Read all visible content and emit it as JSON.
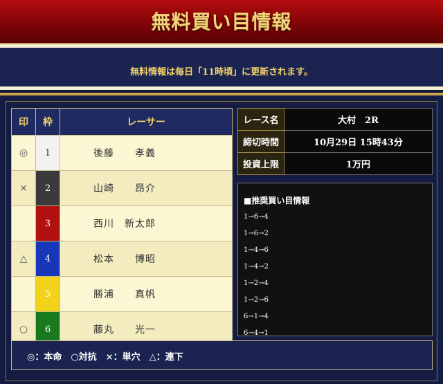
{
  "banner": {
    "title": "無料買い目情報"
  },
  "notice": {
    "text": "無料情報は毎日「11時頃」に更新されます。"
  },
  "table": {
    "headers": [
      "印",
      "枠",
      "レーサー"
    ],
    "rows": [
      {
        "mark": "◎",
        "frame": "1",
        "frame_color": "#f2f2f2",
        "frame_text_color": "#333333",
        "name": "後藤　　孝義"
      },
      {
        "mark": "×",
        "frame": "2",
        "frame_color": "#3a3a3a",
        "frame_text_color": "#ffffff",
        "name": "山崎　　昂介"
      },
      {
        "mark": "",
        "frame": "3",
        "frame_color": "#b01010",
        "frame_text_color": "#ffffff",
        "name": "西川　新太郎"
      },
      {
        "mark": "△",
        "frame": "4",
        "frame_color": "#1736b8",
        "frame_text_color": "#ffffff",
        "name": "松本　　博昭"
      },
      {
        "mark": "",
        "frame": "5",
        "frame_color": "#f2d21a",
        "frame_text_color": "#ffffff",
        "name": "勝浦　　真帆"
      },
      {
        "mark": "○",
        "frame": "6",
        "frame_color": "#187a1c",
        "frame_text_color": "#ffffff",
        "name": "藤丸　　光一"
      }
    ]
  },
  "race_info": [
    {
      "label": "レース名",
      "value": "大村　2R"
    },
    {
      "label": "締切時間",
      "value": "10月29日 15時43分"
    },
    {
      "label": "投資上限",
      "value": "1万円"
    }
  ],
  "recommend": {
    "title": "■推奨買い目情報",
    "items": [
      "1→6→4",
      "1→6→2",
      "1→4→6",
      "1→4→2",
      "1→2→4",
      "1→2→6",
      "6→1→4",
      "6→4→1"
    ]
  },
  "legend": {
    "text": "◎：本命　○対抗　×：単穴　△：連下"
  }
}
